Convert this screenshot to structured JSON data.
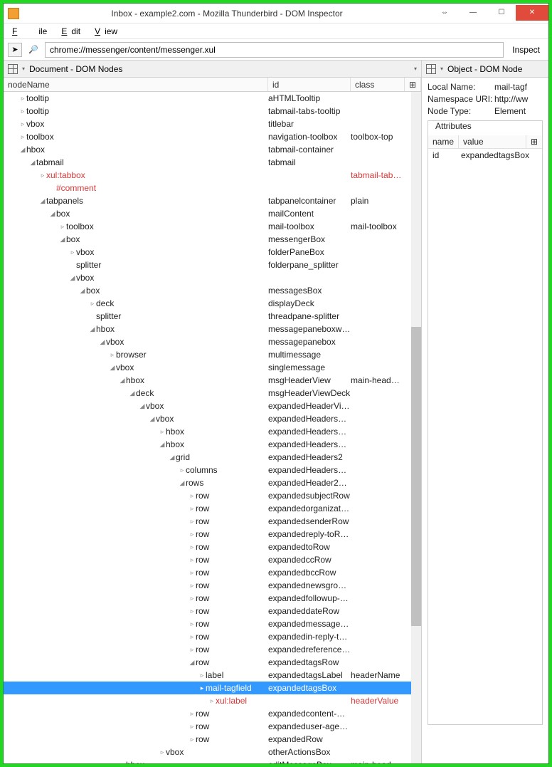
{
  "window": {
    "title": "Inbox - example2.com - Mozilla Thunderbird - DOM Inspector"
  },
  "menu": {
    "file": "File",
    "edit": "Edit",
    "view": "View"
  },
  "urlbar": {
    "value": "chrome://messenger/content/messenger.xul",
    "inspect": "Inspect"
  },
  "leftPanel": {
    "title": "Document - DOM Nodes"
  },
  "rightPanel": {
    "title": "Object - DOM Node"
  },
  "cols": {
    "node": "nodeName",
    "id": "id",
    "class": "class",
    "name": "name",
    "value": "value"
  },
  "nodeInfo": {
    "localNameLabel": "Local Name:",
    "localName": "mail-tagf",
    "nsLabel": "Namespace URI:",
    "ns": "http://ww",
    "typeLabel": "Node Type:",
    "type": "Element",
    "attrsLabel": "Attributes",
    "attrName": "id",
    "attrValue": "expandedtagsBox"
  },
  "tree": [
    {
      "d": 0,
      "t": "▹",
      "n": "tooltip",
      "id": "aHTMLTooltip"
    },
    {
      "d": 0,
      "t": "▹",
      "n": "tooltip",
      "id": "tabmail-tabs-tooltip"
    },
    {
      "d": 0,
      "t": "▹",
      "n": "vbox",
      "id": "titlebar"
    },
    {
      "d": 0,
      "t": "▹",
      "n": "toolbox",
      "id": "navigation-toolbox",
      "cl": "toolbox-top"
    },
    {
      "d": 0,
      "t": "◢",
      "n": "hbox",
      "id": "tabmail-container"
    },
    {
      "d": 1,
      "t": "◢",
      "n": "tabmail",
      "id": "tabmail"
    },
    {
      "d": 2,
      "t": "▹",
      "n": "xul:tabbox",
      "cl": "tabmail-tab…",
      "red": true
    },
    {
      "d": 3,
      "t": "",
      "n": "#comment",
      "red": true
    },
    {
      "d": 2,
      "t": "◢",
      "n": "tabpanels",
      "id": "tabpanelcontainer",
      "cl": "plain"
    },
    {
      "d": 3,
      "t": "◢",
      "n": "box",
      "id": "mailContent"
    },
    {
      "d": 4,
      "t": "▹",
      "n": "toolbox",
      "id": "mail-toolbox",
      "cl": "mail-toolbox"
    },
    {
      "d": 4,
      "t": "◢",
      "n": "box",
      "id": "messengerBox"
    },
    {
      "d": 5,
      "t": "▹",
      "n": "vbox",
      "id": "folderPaneBox"
    },
    {
      "d": 5,
      "t": "",
      "n": "splitter",
      "id": "folderpane_splitter"
    },
    {
      "d": 5,
      "t": "◢",
      "n": "vbox"
    },
    {
      "d": 6,
      "t": "◢",
      "n": "box",
      "id": "messagesBox"
    },
    {
      "d": 7,
      "t": "▹",
      "n": "deck",
      "id": "displayDeck"
    },
    {
      "d": 7,
      "t": "",
      "n": "splitter",
      "id": "threadpane-splitter"
    },
    {
      "d": 7,
      "t": "◢",
      "n": "hbox",
      "id": "messagepaneboxw…"
    },
    {
      "d": 8,
      "t": "◢",
      "n": "vbox",
      "id": "messagepanebox"
    },
    {
      "d": 9,
      "t": "▹",
      "n": "browser",
      "id": "multimessage"
    },
    {
      "d": 9,
      "t": "◢",
      "n": "vbox",
      "id": "singlemessage"
    },
    {
      "d": 10,
      "t": "◢",
      "n": "hbox",
      "id": "msgHeaderView",
      "cl": "main-head…"
    },
    {
      "d": 11,
      "t": "◢",
      "n": "deck",
      "id": "msgHeaderViewDeck"
    },
    {
      "d": 12,
      "t": "◢",
      "n": "vbox",
      "id": "expandedHeaderVi…"
    },
    {
      "d": 13,
      "t": "◢",
      "n": "vbox",
      "id": "expandedHeadersB…"
    },
    {
      "d": 14,
      "t": "▹",
      "n": "hbox",
      "id": "expandedHeadersT…"
    },
    {
      "d": 14,
      "t": "◢",
      "n": "hbox",
      "id": "expandedHeadersB…"
    },
    {
      "d": 15,
      "t": "◢",
      "n": "grid",
      "id": "expandedHeaders2"
    },
    {
      "d": 16,
      "t": "▹",
      "n": "columns",
      "id": "expandedHeaders2…"
    },
    {
      "d": 16,
      "t": "◢",
      "n": "rows",
      "id": "expandedHeader2R…"
    },
    {
      "d": 17,
      "t": "▹",
      "n": "row",
      "id": "expandedsubjectRow"
    },
    {
      "d": 17,
      "t": "▹",
      "n": "row",
      "id": "expandedorganizati…"
    },
    {
      "d": 17,
      "t": "▹",
      "n": "row",
      "id": "expandedsenderRow"
    },
    {
      "d": 17,
      "t": "▹",
      "n": "row",
      "id": "expandedreply-toR…"
    },
    {
      "d": 17,
      "t": "▹",
      "n": "row",
      "id": "expandedtoRow"
    },
    {
      "d": 17,
      "t": "▹",
      "n": "row",
      "id": "expandedccRow"
    },
    {
      "d": 17,
      "t": "▹",
      "n": "row",
      "id": "expandedbccRow"
    },
    {
      "d": 17,
      "t": "▹",
      "n": "row",
      "id": "expandednewsgrou…"
    },
    {
      "d": 17,
      "t": "▹",
      "n": "row",
      "id": "expandedfollowup-…"
    },
    {
      "d": 17,
      "t": "▹",
      "n": "row",
      "id": "expandeddateRow"
    },
    {
      "d": 17,
      "t": "▹",
      "n": "row",
      "id": "expandedmessage-…"
    },
    {
      "d": 17,
      "t": "▹",
      "n": "row",
      "id": "expandedin-reply-t…"
    },
    {
      "d": 17,
      "t": "▹",
      "n": "row",
      "id": "expandedreference…"
    },
    {
      "d": 17,
      "t": "◢",
      "n": "row",
      "id": "expandedtagsRow"
    },
    {
      "d": 18,
      "t": "▹",
      "n": "label",
      "id": "expandedtagsLabel",
      "cl": "headerName"
    },
    {
      "d": 18,
      "t": "▸",
      "n": "mail-tagfield",
      "id": "expandedtagsBox",
      "sel": true
    },
    {
      "d": 19,
      "t": "▹",
      "n": "xul:label",
      "cl": "headerValue",
      "red": true
    },
    {
      "d": 17,
      "t": "▹",
      "n": "row",
      "id": "expandedcontent-…"
    },
    {
      "d": 17,
      "t": "▹",
      "n": "row",
      "id": "expandeduser-age…"
    },
    {
      "d": 17,
      "t": "▹",
      "n": "row",
      "id": "expandedRow"
    },
    {
      "d": 14,
      "t": "▹",
      "n": "vbox",
      "id": "otherActionsBox"
    },
    {
      "d": 10,
      "t": "▹",
      "n": "hbox",
      "id": "editMessageBox",
      "cl": "main-head"
    }
  ]
}
